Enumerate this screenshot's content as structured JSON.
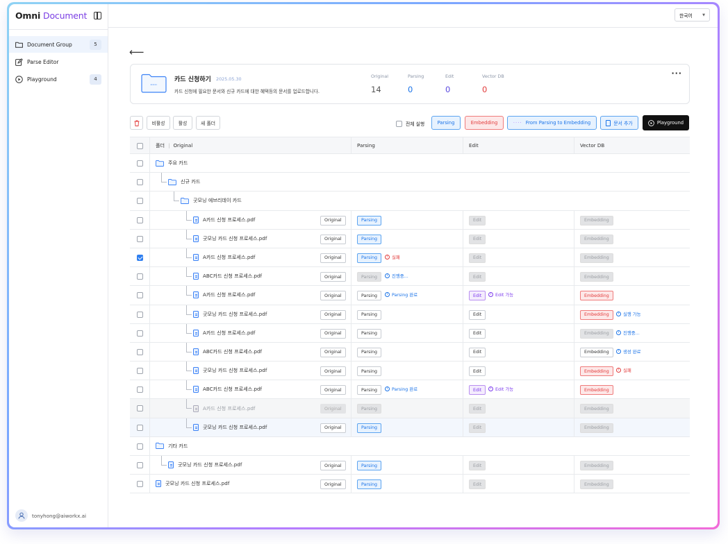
{
  "sidebar": {
    "brand_omni": "Omni",
    "brand_doc": "Document",
    "items": [
      {
        "label": "Document Group",
        "badge": "5"
      },
      {
        "label": "Parse Editor",
        "badge": ""
      },
      {
        "label": "Playground",
        "badge": "4"
      }
    ],
    "user": "tonyhong@aiworkx.ai"
  },
  "topbar": {
    "language": "한국어"
  },
  "group": {
    "title": "카드 신청하기",
    "date": "2025.05.30",
    "description": "카드 신청에 필요한 문서와 신규 카드에 대한 혜택등의 문서를 업로드합니다.",
    "stats": [
      {
        "label": "Original",
        "value": "14",
        "color": "#555555"
      },
      {
        "label": "Parsing",
        "value": "0",
        "color": "#1a73e8"
      },
      {
        "label": "Edit",
        "value": "0",
        "color": "#5b4ae0"
      },
      {
        "label": "Vector DB",
        "value": "0",
        "color": "#e23b3b"
      }
    ]
  },
  "toolbar": {
    "deactivate": "비활성",
    "activate": "활성",
    "new_folder": "새 폴더",
    "run_all": "전체 실행",
    "parsing": "Parsing",
    "embedding": "Embedding",
    "from_to": "From Parsing to Embedding",
    "add_doc": "문서 추가",
    "playground": "Playground"
  },
  "table": {
    "headers": {
      "folder": "폴더",
      "original": "Original",
      "parsing": "Parsing",
      "edit": "Edit",
      "vector": "Vector DB"
    },
    "rows": [
      {
        "kind": "folder",
        "name": "주요 카드",
        "level": 0
      },
      {
        "kind": "folder",
        "name": "신규 카드",
        "level": 1
      },
      {
        "kind": "folder",
        "name": "굿모닝 에브리데이 카드",
        "level": 2
      },
      {
        "kind": "file",
        "name": "A카드 신청 프로세스.pdf",
        "level": 3,
        "original": "Original",
        "parsing": {
          "label": "Parsing",
          "style": "blue"
        },
        "edit": {
          "label": "Edit",
          "style": "grey"
        },
        "vector": {
          "label": "Embedding",
          "style": "grey"
        }
      },
      {
        "kind": "file",
        "name": "굿모닝 카드 신청 프로세스.pdf",
        "level": 3,
        "original": "Original",
        "parsing": {
          "label": "Parsing",
          "style": "blue"
        },
        "edit": {
          "label": "Edit",
          "style": "grey"
        },
        "vector": {
          "label": "Embedding",
          "style": "grey"
        }
      },
      {
        "kind": "file",
        "name": "A카드 신청 프로세스.pdf",
        "level": 3,
        "checked": true,
        "original": "Original",
        "parsing": {
          "label": "Parsing",
          "style": "blue",
          "status": "실패",
          "status_color": "red"
        },
        "edit": {
          "label": "Edit",
          "style": "grey"
        },
        "vector": {
          "label": "Embedding",
          "style": "grey"
        }
      },
      {
        "kind": "file",
        "name": "ABC카드 신청 프로세스.pdf",
        "level": 3,
        "original": "Original",
        "parsing": {
          "label": "Parsing",
          "style": "grey",
          "status": "진행중...",
          "status_color": "blue"
        },
        "edit": {
          "label": "Edit",
          "style": "grey"
        },
        "vector": {
          "label": "Embedding",
          "style": "grey"
        }
      },
      {
        "kind": "file",
        "name": "A카드 신청 프로세스.pdf",
        "level": 3,
        "original": "Original",
        "parsing": {
          "label": "Parsing",
          "style": "white",
          "status": "Parsing 완료",
          "status_color": "blue"
        },
        "edit": {
          "label": "Edit",
          "style": "purple",
          "status": "Edit 가능",
          "status_color": "purple"
        },
        "vector": {
          "label": "Embedding",
          "style": "red"
        }
      },
      {
        "kind": "file",
        "name": "굿모닝 카드 신청 프로세스.pdf",
        "level": 3,
        "original": "Original",
        "parsing": {
          "label": "Parsing",
          "style": "white"
        },
        "edit": {
          "label": "Edit",
          "style": "white"
        },
        "vector": {
          "label": "Embedding",
          "style": "red",
          "status": "실행 가능",
          "status_color": "blue"
        }
      },
      {
        "kind": "file",
        "name": "A카드 신청 프로세스.pdf",
        "level": 3,
        "original": "Original",
        "parsing": {
          "label": "Parsing",
          "style": "white"
        },
        "edit": {
          "label": "Edit",
          "style": "white"
        },
        "vector": {
          "label": "Embedding",
          "style": "grey",
          "status": "진행중...",
          "status_color": "blue"
        }
      },
      {
        "kind": "file",
        "name": "ABC카드 신청 프로세스.pdf",
        "level": 3,
        "original": "Original",
        "parsing": {
          "label": "Parsing",
          "style": "white"
        },
        "edit": {
          "label": "Edit",
          "style": "white"
        },
        "vector": {
          "label": "Embedding",
          "style": "white",
          "status": "생성 완료",
          "status_color": "blue"
        }
      },
      {
        "kind": "file",
        "name": "굿모닝 카드 신청 프로세스.pdf",
        "level": 3,
        "original": "Original",
        "parsing": {
          "label": "Parsing",
          "style": "white"
        },
        "edit": {
          "label": "Edit",
          "style": "white"
        },
        "vector": {
          "label": "Embedding",
          "style": "red",
          "status": "실패",
          "status_color": "red"
        }
      },
      {
        "kind": "file",
        "name": "ABC카드 신청 프로세스.pdf",
        "level": 3,
        "original": "Original",
        "parsing": {
          "label": "Parsing",
          "style": "white",
          "status": "Parsing 완료",
          "status_color": "blue"
        },
        "edit": {
          "label": "Edit",
          "style": "purple",
          "status": "Edit 가능",
          "status_color": "purple"
        },
        "vector": {
          "label": "Embedding",
          "style": "red"
        }
      },
      {
        "kind": "file",
        "name": "A카드 신청 프로세스.pdf",
        "level": 3,
        "dim": true,
        "original": "Original",
        "parsing": {
          "label": "Parsing",
          "style": "grey"
        },
        "edit": {
          "label": "Edit",
          "style": "grey"
        },
        "vector": {
          "label": "Embedding",
          "style": "grey"
        }
      },
      {
        "kind": "file",
        "name": "굿모닝 카드 신청 프로세스.pdf",
        "level": 3,
        "highlight": true,
        "original": "Original",
        "parsing": {
          "label": "Parsing",
          "style": "blue"
        },
        "edit": {
          "label": "Edit",
          "style": "grey"
        },
        "vector": {
          "label": "Embedding",
          "style": "grey"
        }
      },
      {
        "kind": "folder",
        "name": "기타 카드",
        "level": 0
      },
      {
        "kind": "file",
        "name": "굿모닝 카드 신청 프로세스.pdf",
        "level": 1,
        "original": "Original",
        "parsing": {
          "label": "Parsing",
          "style": "blue"
        },
        "edit": {
          "label": "Edit",
          "style": "grey"
        },
        "vector": {
          "label": "Embedding",
          "style": "grey"
        }
      },
      {
        "kind": "file",
        "name": "굿모닝 카드 신청 프로세스.pdf",
        "level": 0,
        "original": "Original",
        "parsing": {
          "label": "Parsing",
          "style": "blue"
        },
        "edit": {
          "label": "Edit",
          "style": "grey"
        },
        "vector": {
          "label": "Embedding",
          "style": "grey"
        }
      }
    ]
  }
}
